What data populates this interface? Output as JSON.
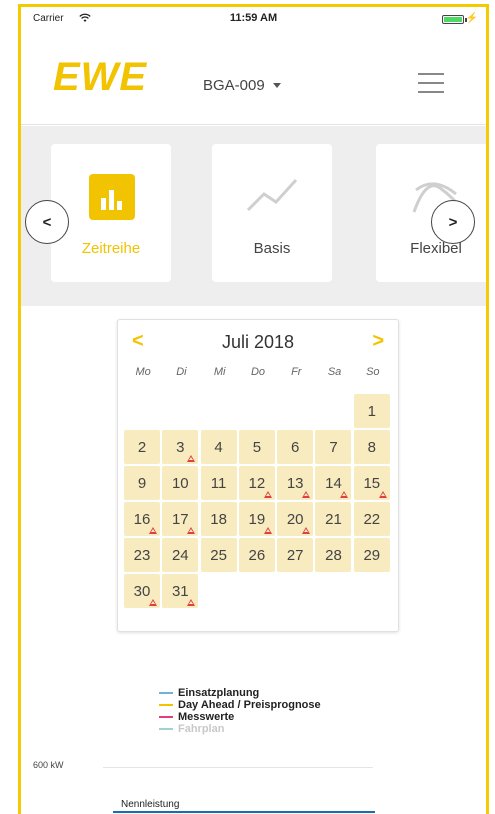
{
  "status_bar": {
    "carrier": "Carrier",
    "time": "11:59 AM"
  },
  "header": {
    "logo": "EWE",
    "device": "BGA-009"
  },
  "tabs": [
    {
      "label": "Zeitreihe",
      "active": true
    },
    {
      "label": "Basis",
      "active": false
    },
    {
      "label": "Flexibel",
      "active": false
    }
  ],
  "nav": {
    "prev": "<",
    "next": ">"
  },
  "calendar": {
    "title": "Juli 2018",
    "prev": "<",
    "next": ">",
    "weekdays": [
      "Mo",
      "Di",
      "Mi",
      "Do",
      "Fr",
      "Sa",
      "So"
    ],
    "leading_blanks": 6,
    "days": [
      "1",
      "2",
      "3",
      "4",
      "5",
      "6",
      "7",
      "8",
      "9",
      "10",
      "11",
      "12",
      "13",
      "14",
      "15",
      "16",
      "17",
      "18",
      "19",
      "20",
      "21",
      "22",
      "23",
      "24",
      "25",
      "26",
      "27",
      "28",
      "29",
      "30",
      "31"
    ],
    "warning_days": [
      3,
      12,
      13,
      14,
      15,
      16,
      17,
      19,
      20,
      30,
      31
    ]
  },
  "legend": [
    {
      "label": "Einsatzplanung",
      "color": "#6fb3d6",
      "faded": false
    },
    {
      "label": "Day Ahead / Preisprognose",
      "color": "#f2c300",
      "faded": false
    },
    {
      "label": "Messwerte",
      "color": "#e0407a",
      "faded": false
    },
    {
      "label": "Fahrplan",
      "color": "#9fd3cf",
      "faded": true
    }
  ],
  "chart": {
    "ytick_top": "600 kW",
    "reference_label": "Nennleistung"
  },
  "colors": {
    "accent": "#f2c300",
    "day_bg": "#f8ebbf",
    "warning": "#e04040"
  }
}
